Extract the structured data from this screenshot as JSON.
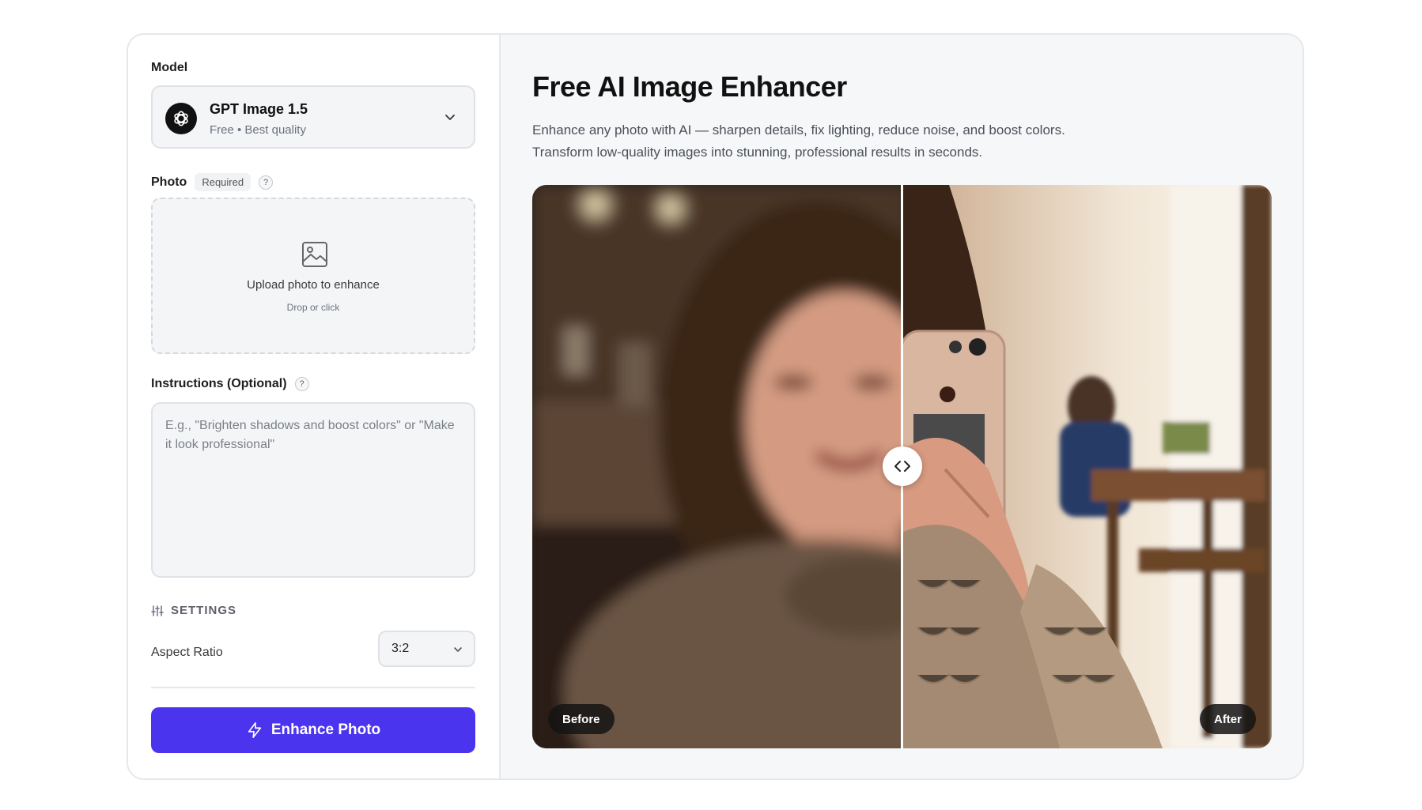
{
  "form": {
    "model_label": "Model",
    "model": {
      "name": "GPT Image 1.5",
      "subtitle": "Free • Best quality",
      "icon": "openai-logo-icon"
    },
    "photo_label": "Photo",
    "photo_badge": "Required",
    "help_glyph": "?",
    "upload": {
      "title": "Upload photo to enhance",
      "hint": "Drop or click",
      "icon": "image-icon"
    },
    "instructions_label": "Instructions (Optional)",
    "instructions_placeholder": "E.g., \"Brighten shadows and boost colors\" or \"Make it look professional\"",
    "settings_label": "SETTINGS",
    "aspect_ratio_label": "Aspect Ratio",
    "aspect_ratio_value": "3:2",
    "cta_label": "Enhance Photo",
    "cta_color": "#4b34ee"
  },
  "hero": {
    "title": "Free AI Image Enhancer",
    "description_line1": "Enhance any photo with AI — sharpen details, fix lighting, reduce noise, and boost colors.",
    "description_line2": "Transform low-quality images into stunning, professional results in seconds."
  },
  "comparison": {
    "before_label": "Before",
    "after_label": "After",
    "split_position": 0.5
  }
}
